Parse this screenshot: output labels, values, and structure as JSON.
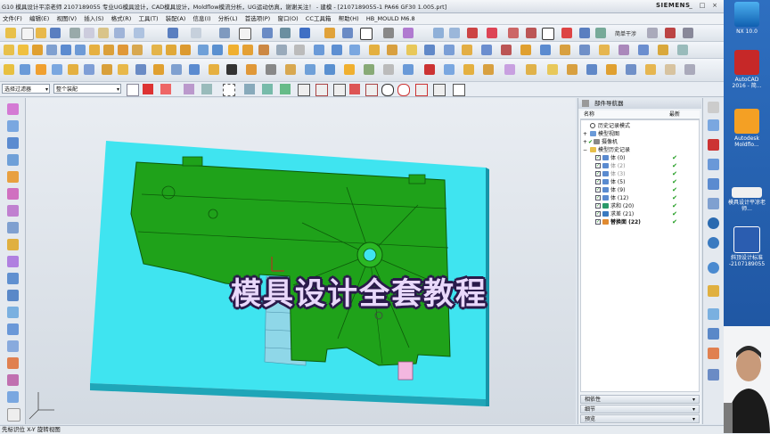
{
  "app": {
    "title": "G10 模具设计平凉老师 2107189055 专业UG模具设计，CAD模具设计，Moldflow模流分析，UG运动仿真，谢谢关注！ - 建模 - [2107189055-1 PA66 GF30 1.005.prt]",
    "brand": "SIEMENS"
  },
  "window_controls": [
    "_",
    "□",
    "×"
  ],
  "menu": [
    "文件(F)",
    "编辑(E)",
    "视图(V)",
    "插入(S)",
    "格式(R)",
    "工具(T)",
    "装配(A)",
    "信息(I)",
    "分析(L)",
    "首选项(P)",
    "窗口(O)",
    "CC工具箱",
    "帮助(H)",
    "HB_MOULD M6.8"
  ],
  "toolbar": {
    "simple_tool_label": "简单干涉"
  },
  "selection": {
    "filter_value": "选择过滤器",
    "scope_value": "整个装配"
  },
  "overlay": {
    "banner": "模具设计全套教程"
  },
  "navigator": {
    "title": "部件导航器",
    "col_name": "名称",
    "col_latest": "最新",
    "tree": [
      {
        "label": "历史记录模式",
        "indent": 1,
        "type": "clock",
        "check": ""
      },
      {
        "label": "模型视图",
        "indent": 0,
        "type": "plus",
        "check": ""
      },
      {
        "label": "摄像机",
        "indent": 0,
        "type": "plus-check",
        "check": ""
      },
      {
        "label": "模型历史记录",
        "indent": 0,
        "type": "folder",
        "check": ""
      },
      {
        "label": "体 (0)",
        "indent": 2,
        "type": "body",
        "check": "✔"
      },
      {
        "label": "体 (2)",
        "indent": 2,
        "type": "body",
        "check": "✔"
      },
      {
        "label": "体 (3)",
        "indent": 2,
        "type": "body",
        "check": "✔"
      },
      {
        "label": "体 (5)",
        "indent": 2,
        "type": "body",
        "check": "✔"
      },
      {
        "label": "体 (9)",
        "indent": 2,
        "type": "body",
        "check": "✔"
      },
      {
        "label": "体 (12)",
        "indent": 2,
        "type": "body",
        "check": "✔"
      },
      {
        "label": "求和 (20)",
        "indent": 2,
        "type": "unite",
        "check": "✔"
      },
      {
        "label": "求差 (21)",
        "indent": 2,
        "type": "subtract",
        "check": "✔"
      },
      {
        "label": "替换面 (22)",
        "indent": 2,
        "type": "replace",
        "check": "✔"
      }
    ],
    "panels": [
      "相依性",
      "细节",
      "预览"
    ]
  },
  "status": {
    "text": "先标识位 X-Y 旋转视图"
  },
  "desktop": {
    "icons": [
      {
        "label": "NX 10.0"
      },
      {
        "label": "AutoCAD 2016 - 简..."
      },
      {
        "label": "Autodesk Moldflo..."
      },
      {
        "label": "模具设计平凉老师..."
      },
      {
        "label": "斜顶设计标准 -2107189055"
      }
    ]
  },
  "colors": {
    "mold_block": "#3fe4f0",
    "part_green": "#1fa21a",
    "banner_fill": "#e9d8fb",
    "banner_outline": "#2a1a4a",
    "desktop_blue": "#2461b3"
  }
}
